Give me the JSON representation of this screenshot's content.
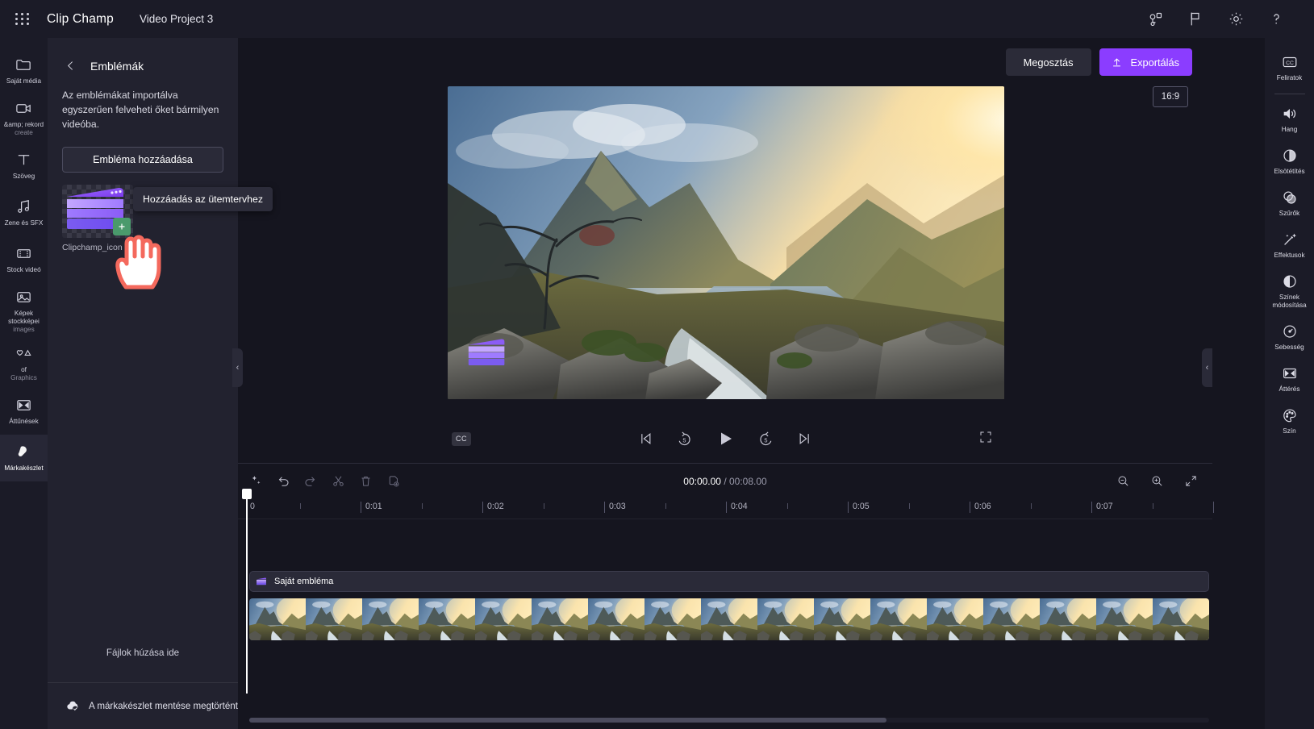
{
  "app": {
    "brand": "Clip Champ",
    "project_name": "Video Project 3",
    "accent": "#8b3dff",
    "bg": "#15151f",
    "panel_bg": "#22222f"
  },
  "topbar": {
    "waffle_icon": "app-launcher-icon",
    "icons": [
      {
        "name": "collaborate-icon",
        "label": "Collaborate"
      },
      {
        "name": "flag-feedback-icon",
        "label": "Feedback"
      },
      {
        "name": "gear-icon",
        "label": "Settings"
      },
      {
        "name": "help-icon",
        "label": "Help"
      }
    ]
  },
  "left_rail": [
    {
      "icon": "folder-icon",
      "label": "Saját média",
      "sublabel": "",
      "active": false
    },
    {
      "icon": "video-camera-icon",
      "label": "&amp; rekord",
      "sublabel": "create",
      "active": false
    },
    {
      "icon": "text-t-icon",
      "label": "Szöveg",
      "sublabel": "",
      "active": false
    },
    {
      "icon": "music-note-icon",
      "label": "Zene és SFX",
      "sublabel": "",
      "active": false
    },
    {
      "icon": "film-strip-icon",
      "label": "Stock videó",
      "sublabel": "",
      "active": false
    },
    {
      "icon": "image-icon",
      "label": "Képek stockképei",
      "sublabel": "images",
      "active": false
    },
    {
      "icon": "shapes-icon",
      "label": "of",
      "sublabel": "Graphics",
      "active": false
    },
    {
      "icon": "transition-icon",
      "label": "Áttűnések",
      "sublabel": "",
      "active": false
    },
    {
      "icon": "brandkit-icon",
      "label": "Márkakészlet",
      "sublabel": "",
      "active": true
    }
  ],
  "panel": {
    "back_icon": "arrow-left-icon",
    "title": "Emblémák",
    "description": "Az emblémákat importálva egyszerűen felveheti őket bármilyen videóba.",
    "add_button": "Embléma hozzáadása",
    "asset": {
      "name": "Clipchamp_icon",
      "plus_icon": "plus-icon",
      "tooltip": "Hozzáadás az ütemtervhez"
    },
    "drop_hint": "Fájlok húzása ide",
    "footer": {
      "icon": "cloud-check-icon",
      "text": "A márkakészlet mentése megtörtént"
    }
  },
  "stage": {
    "share_button": "Megosztás",
    "export_button": "Exportálás",
    "export_icon": "upload-arrow-icon",
    "aspect_ratio": "16:9"
  },
  "player": {
    "cc_label": "CC",
    "controls": [
      {
        "name": "skip-previous-icon",
        "label": "Előző"
      },
      {
        "name": "rewind-5-icon",
        "label": "5"
      },
      {
        "name": "play-icon",
        "label": "Lejátszás"
      },
      {
        "name": "forward-5-icon",
        "label": "5"
      },
      {
        "name": "skip-next-icon",
        "label": "Következő"
      }
    ],
    "fullscreen_icon": "fullscreen-icon"
  },
  "timeline": {
    "tools": [
      {
        "name": "magic-wand-icon",
        "dim": false
      },
      {
        "name": "undo-icon",
        "dim": false
      },
      {
        "name": "redo-icon",
        "dim": true
      },
      {
        "name": "scissors-split-icon",
        "dim": true
      },
      {
        "name": "trash-delete-icon",
        "dim": true
      },
      {
        "name": "duplicate-icon",
        "dim": true
      }
    ],
    "current_time": "00:00.00",
    "separator": " / ",
    "total_time": "00:08.00",
    "zoom_tools": [
      {
        "name": "zoom-out-icon"
      },
      {
        "name": "zoom-in-icon"
      },
      {
        "name": "fit-to-screen-icon"
      }
    ],
    "ruler_labels": [
      "0",
      "0:01",
      "0:02",
      "0:03",
      "0:04",
      "0:05",
      "0:06",
      "0:07"
    ],
    "playhead_time": "0",
    "tracks": [
      {
        "name": "Saját embléma",
        "type": "logo-overlay"
      },
      {
        "name": "",
        "type": "video-filmstrip"
      }
    ]
  },
  "right_rail": [
    {
      "icon": "closed-caption-icon",
      "label": "Feliratok",
      "sep_after": true
    },
    {
      "icon": "speaker-volume-icon",
      "label": "Hang",
      "sep_after": false
    },
    {
      "icon": "fade-contrast-icon",
      "label": "Elsötétítés",
      "sep_after": false
    },
    {
      "icon": "filters-circles-icon",
      "label": "Szűrők",
      "sep_after": false
    },
    {
      "icon": "sparkle-wand-icon",
      "label": "Effektusok",
      "sep_after": false
    },
    {
      "icon": "half-circle-icon",
      "label": "Színek módosítása",
      "sep_after": false
    },
    {
      "icon": "speedometer-icon",
      "label": "Sebesség",
      "sep_after": false
    },
    {
      "icon": "transition-icon",
      "label": "Áttérés",
      "sep_after": false
    },
    {
      "icon": "palette-icon",
      "label": "Szín",
      "sep_after": false
    }
  ]
}
